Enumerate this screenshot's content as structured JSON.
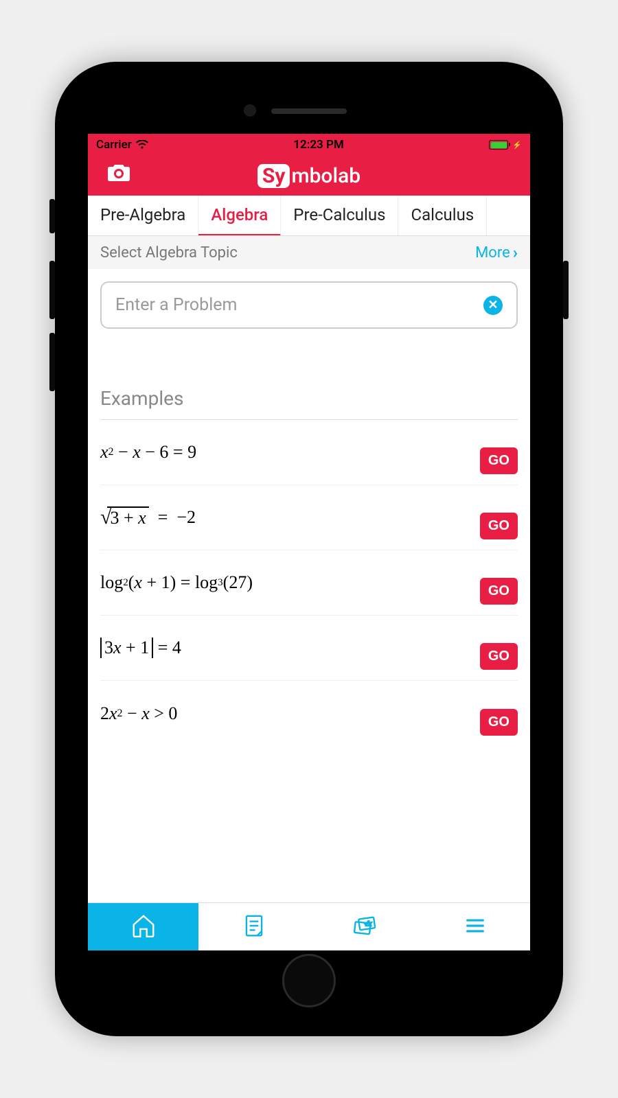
{
  "status": {
    "carrier": "Carrier",
    "time": "12:23 PM"
  },
  "header": {
    "logo_prefix": "Sy",
    "logo_suffix": "mbolab"
  },
  "tabs": [
    {
      "label": "Pre-Algebra",
      "active": false
    },
    {
      "label": "Algebra",
      "active": true
    },
    {
      "label": "Pre-Calculus",
      "active": false
    },
    {
      "label": "Calculus",
      "active": false
    }
  ],
  "topic": {
    "label": "Select Algebra Topic",
    "more": "More"
  },
  "input": {
    "placeholder": "Enter a Problem"
  },
  "examples": {
    "title": "Examples",
    "go_label": "GO",
    "items": [
      {
        "formula": "x² − x − 6 = 9"
      },
      {
        "formula": "√(3 + x) = −2"
      },
      {
        "formula": "log₂(x + 1) = log₃(27)"
      },
      {
        "formula": "|3x + 1| = 4"
      },
      {
        "formula": "2x² − x > 0"
      }
    ]
  }
}
